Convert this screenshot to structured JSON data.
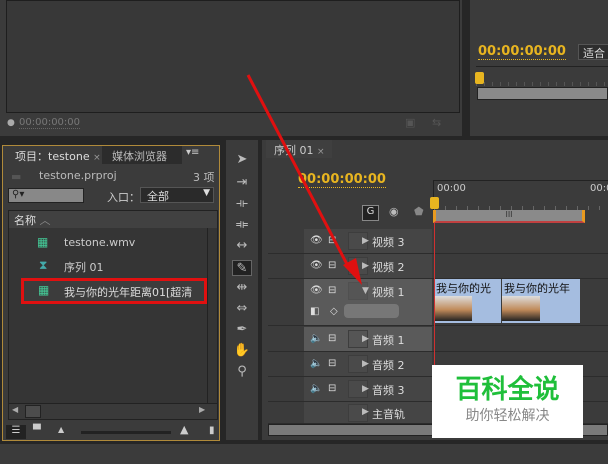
{
  "program_monitor": {
    "timecode": "00:00:00:00"
  },
  "source_monitor": {
    "timecode": "00:00:00:00",
    "fit_label": "适合"
  },
  "project": {
    "tabs": [
      {
        "label": "项目：testone",
        "close": "×"
      },
      {
        "label": "媒体浏览器"
      }
    ],
    "file": "testone.prproj",
    "count": "3 项",
    "entry_label": "入口：",
    "entry_value": "全部",
    "column_name": "名称",
    "items": [
      {
        "label": "testone.wmv",
        "icon": "video-clip-icon"
      },
      {
        "label": "序列 01",
        "icon": "sequence-icon"
      },
      {
        "label": "我与你的光年距离01[超清",
        "icon": "video-clip-icon"
      }
    ]
  },
  "sequence": {
    "tab": "序列 01",
    "close": "×",
    "timecode": "00:00:00:00",
    "ruler_start": "00:00",
    "ruler_next": "00:0",
    "tracks": [
      {
        "label": "视频 3"
      },
      {
        "label": "视频 2"
      },
      {
        "label": "视频 1"
      },
      {
        "label": "音频 1"
      },
      {
        "label": "音频 2"
      },
      {
        "label": "音频 3"
      },
      {
        "label": "主音轨"
      }
    ],
    "clips": [
      {
        "label": "我与你的光"
      },
      {
        "label": "我与你的光年"
      }
    ]
  },
  "tools": [
    "selection-tool",
    "track-select-tool",
    "ripple-edit-tool",
    "rolling-edit-tool",
    "rate-stretch-tool",
    "razor-tool",
    "slip-tool",
    "slide-tool",
    "pen-tool",
    "hand-tool",
    "zoom-tool"
  ],
  "watermark": {
    "title": "百科全说",
    "subtitle": "助你轻松解决"
  },
  "colors": {
    "accent": "#e8b520",
    "highlight": "#e01010",
    "clip": "#a5bde0"
  }
}
